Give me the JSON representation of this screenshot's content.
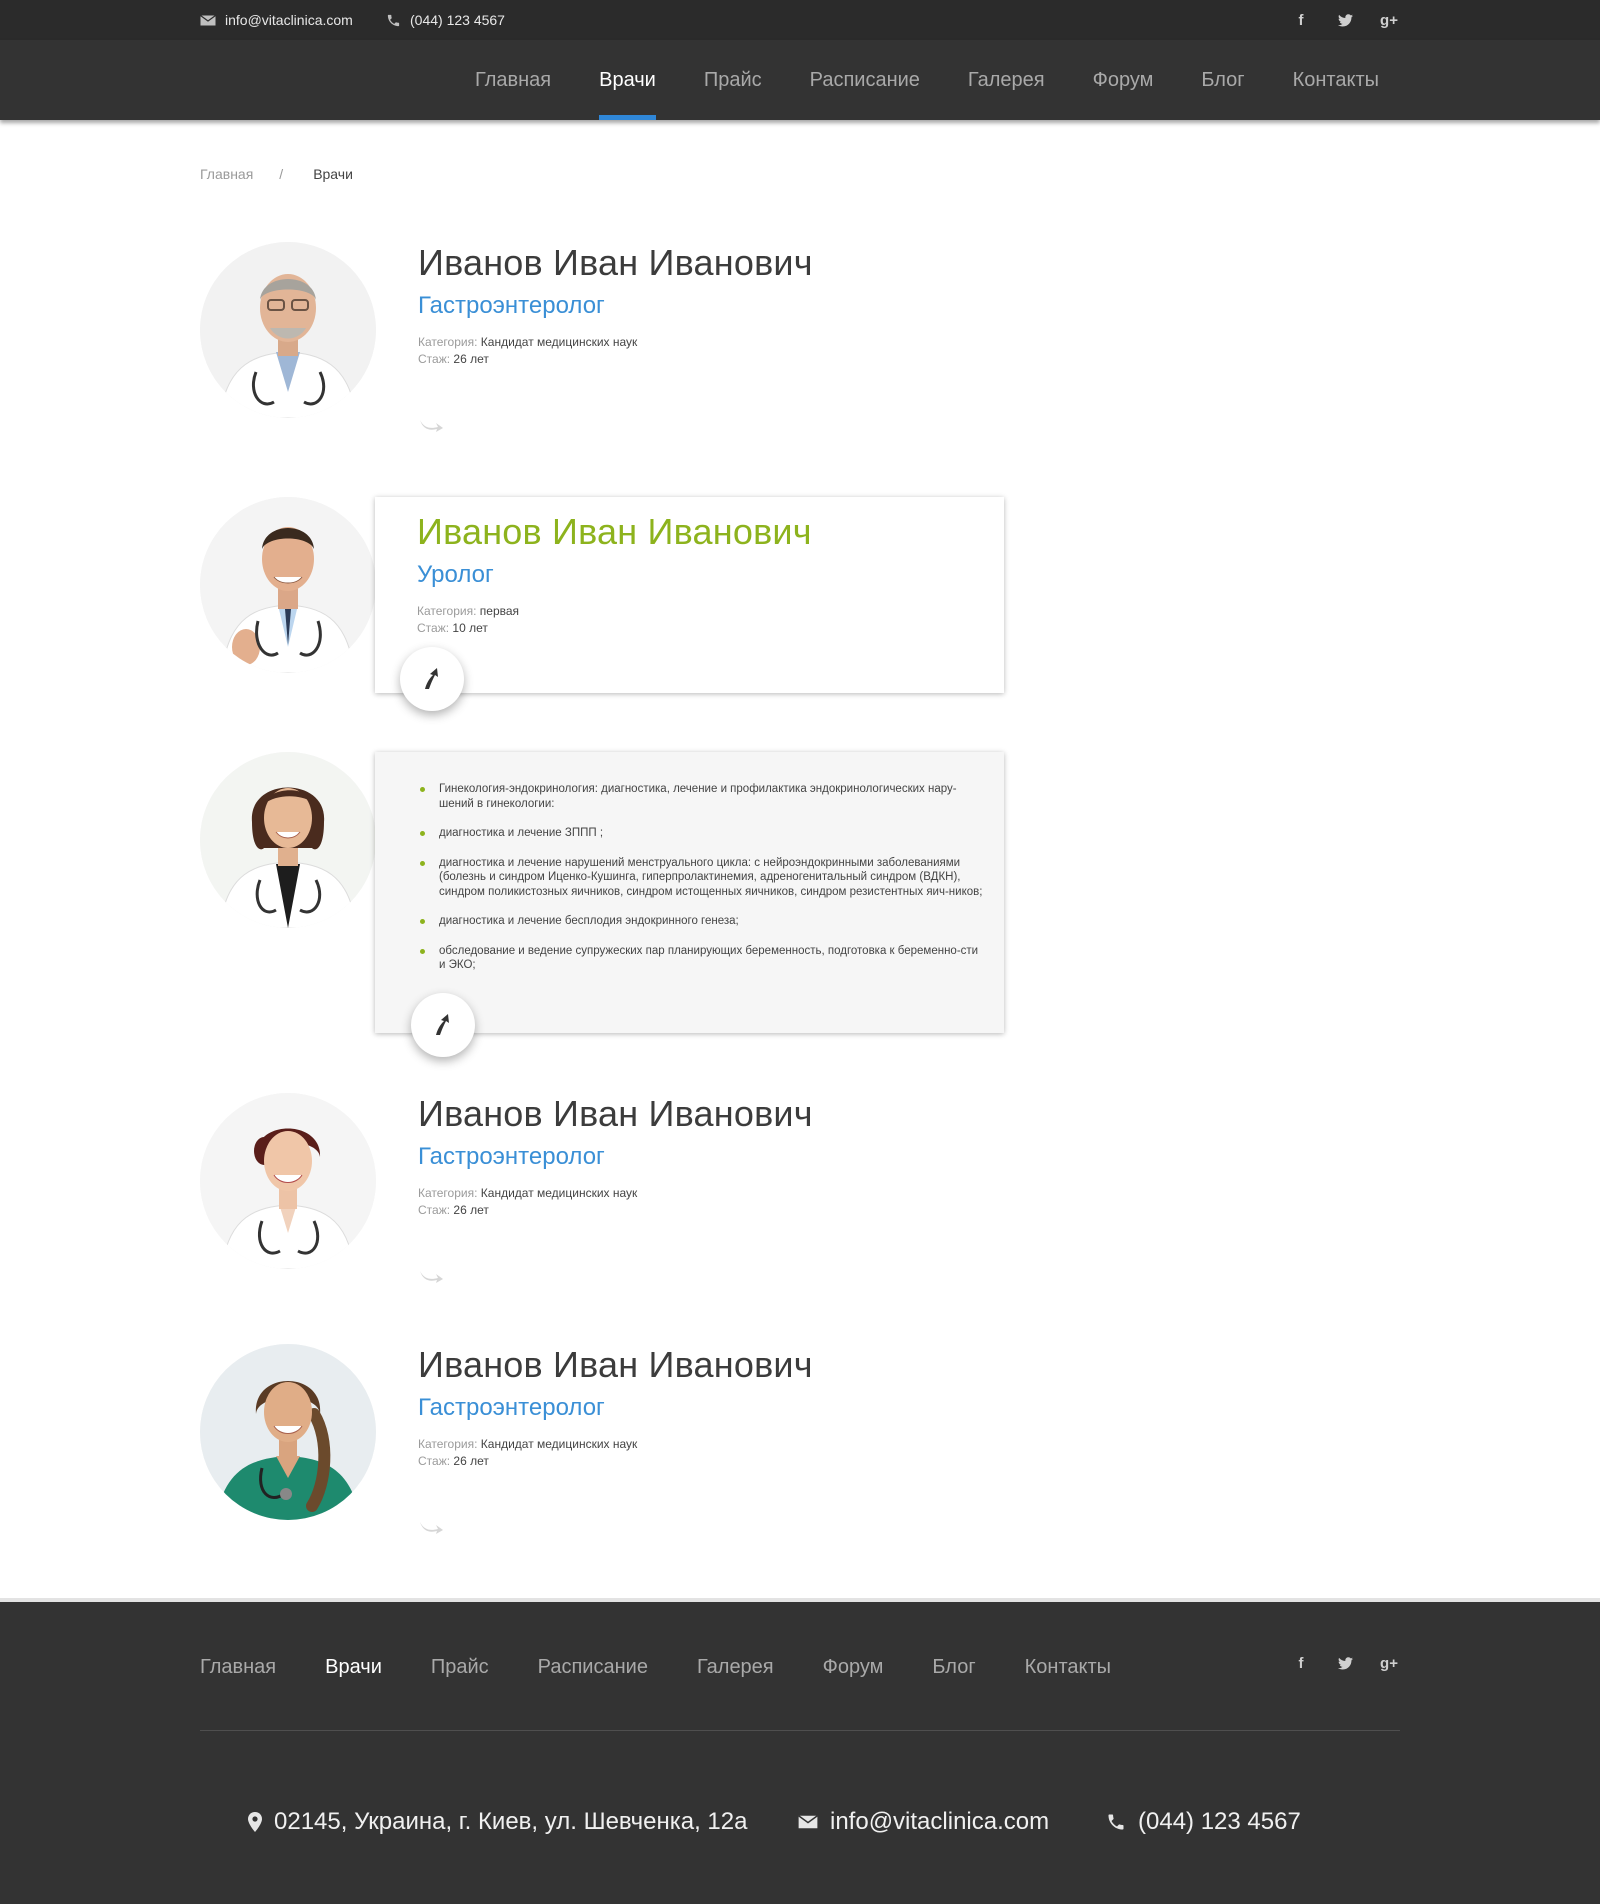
{
  "topbar": {
    "email": "info@vitaclinica.com",
    "phone": "(044) 123 4567",
    "social": [
      {
        "icon": "facebook-icon",
        "glyph": "f"
      },
      {
        "icon": "twitter-icon",
        "glyph": "t"
      },
      {
        "icon": "google-plus-icon",
        "glyph": "g+"
      }
    ]
  },
  "nav": {
    "items": [
      "Главная",
      "Врачи",
      "Прайс",
      "Расписание",
      "Галерея",
      "Форум",
      "Блог",
      "Контакты"
    ],
    "active_index": 1
  },
  "breadcrumb": {
    "home": "Главная",
    "separator": "/",
    "current": "Врачи"
  },
  "doctors": [
    {
      "name": "Иванов Иван Иванович",
      "specialty": "Гастроэнтеролог",
      "category_label": "Категория:",
      "category": "Кандидат медицинских наук",
      "experience_label": "Стаж:",
      "experience": "26 лет"
    },
    {
      "name": "Иванов Иван Иванович",
      "specialty": "Уролог",
      "category_label": "Категория:",
      "category": "первая",
      "experience_label": "Стаж:",
      "experience": "10 лет"
    },
    {
      "details": [
        "Гинекология-эндокринология: диагностика, лечение и профилактика эндокринологических нару-шений в гинекологии:",
        "диагностика и лечение ЗППП ;",
        "диагностика и лечение нарушений менструального цикла: с нейроэндокринными заболеваниями (болезнь и синдром Иценко-Кушинга, гиперпролактинемия, адреногенитальный синдром (ВДКН), синдром поликистозных яичников, синдром истощенных яичников, синдром резистентных яич-ников;",
        "диагностика и лечение бесплодия эндокринного генеза;",
        "обследование и ведение супружеских пар планирующих беременность, подготовка к беременно-сти и ЭКО;"
      ]
    },
    {
      "name": "Иванов Иван Иванович",
      "specialty": "Гастроэнтеролог",
      "category_label": "Категория:",
      "category": "Кандидат медицинских наук",
      "experience_label": "Стаж:",
      "experience": "26 лет"
    },
    {
      "name": "Иванов Иван Иванович",
      "specialty": "Гастроэнтеролог",
      "category_label": "Категория:",
      "category": "Кандидат медицинских наук",
      "experience_label": "Стаж:",
      "experience": "26 лет"
    }
  ],
  "footer": {
    "nav": [
      "Главная",
      "Врачи",
      "Прайс",
      "Расписание",
      "Галерея",
      "Форум",
      "Блог",
      "Контакты"
    ],
    "active_index": 1,
    "address": "02145, Украина, г. Киев, ул. Шевченка, 12а",
    "email": "info@vitaclinica.com",
    "phone": "(044) 123 4567"
  },
  "colors": {
    "accent_blue": "#3a8fd6",
    "accent_green": "#8db31d",
    "dark_bg": "#333333",
    "topbar_bg": "#2b2b2b"
  }
}
